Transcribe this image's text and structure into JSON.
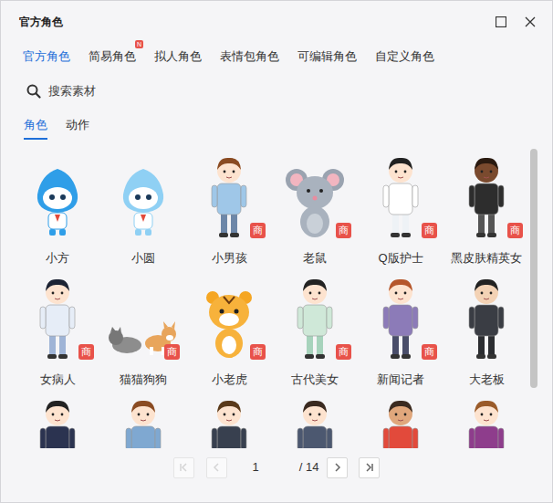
{
  "window": {
    "title": "官方角色"
  },
  "tabs": [
    {
      "label": "官方角色",
      "selected": true,
      "badge": null
    },
    {
      "label": "简易角色",
      "selected": false,
      "badge": "N"
    },
    {
      "label": "拟人角色",
      "selected": false,
      "badge": null
    },
    {
      "label": "表情包角色",
      "selected": false,
      "badge": null
    },
    {
      "label": "可编辑角色",
      "selected": false,
      "badge": null
    },
    {
      "label": "自定义角色",
      "selected": false,
      "badge": null
    }
  ],
  "search": {
    "placeholder": "搜索素材"
  },
  "subtabs": [
    {
      "label": "角色",
      "selected": true
    },
    {
      "label": "动作",
      "selected": false
    }
  ],
  "items": [
    {
      "name": "小方",
      "badge": null
    },
    {
      "name": "小圆",
      "badge": null
    },
    {
      "name": "小男孩",
      "badge": "商"
    },
    {
      "name": "老鼠",
      "badge": "商"
    },
    {
      "name": "Q版护士",
      "badge": "商"
    },
    {
      "name": "黑皮肤精英女",
      "badge": "商"
    },
    {
      "name": "女病人",
      "badge": "商"
    },
    {
      "name": "猫猫狗狗",
      "badge": "商"
    },
    {
      "name": "小老虎",
      "badge": "商"
    },
    {
      "name": "古代美女",
      "badge": "商"
    },
    {
      "name": "新闻记者",
      "badge": "商"
    },
    {
      "name": "大老板",
      "badge": null
    },
    {
      "name": null,
      "badge": null
    },
    {
      "name": null,
      "badge": null
    },
    {
      "name": null,
      "badge": null
    },
    {
      "name": null,
      "badge": null
    },
    {
      "name": null,
      "badge": null
    },
    {
      "name": null,
      "badge": null
    }
  ],
  "pagination": {
    "current": "1",
    "total": "/ 14",
    "first_disabled": true,
    "prev_disabled": true,
    "next_disabled": false,
    "last_disabled": false
  }
}
